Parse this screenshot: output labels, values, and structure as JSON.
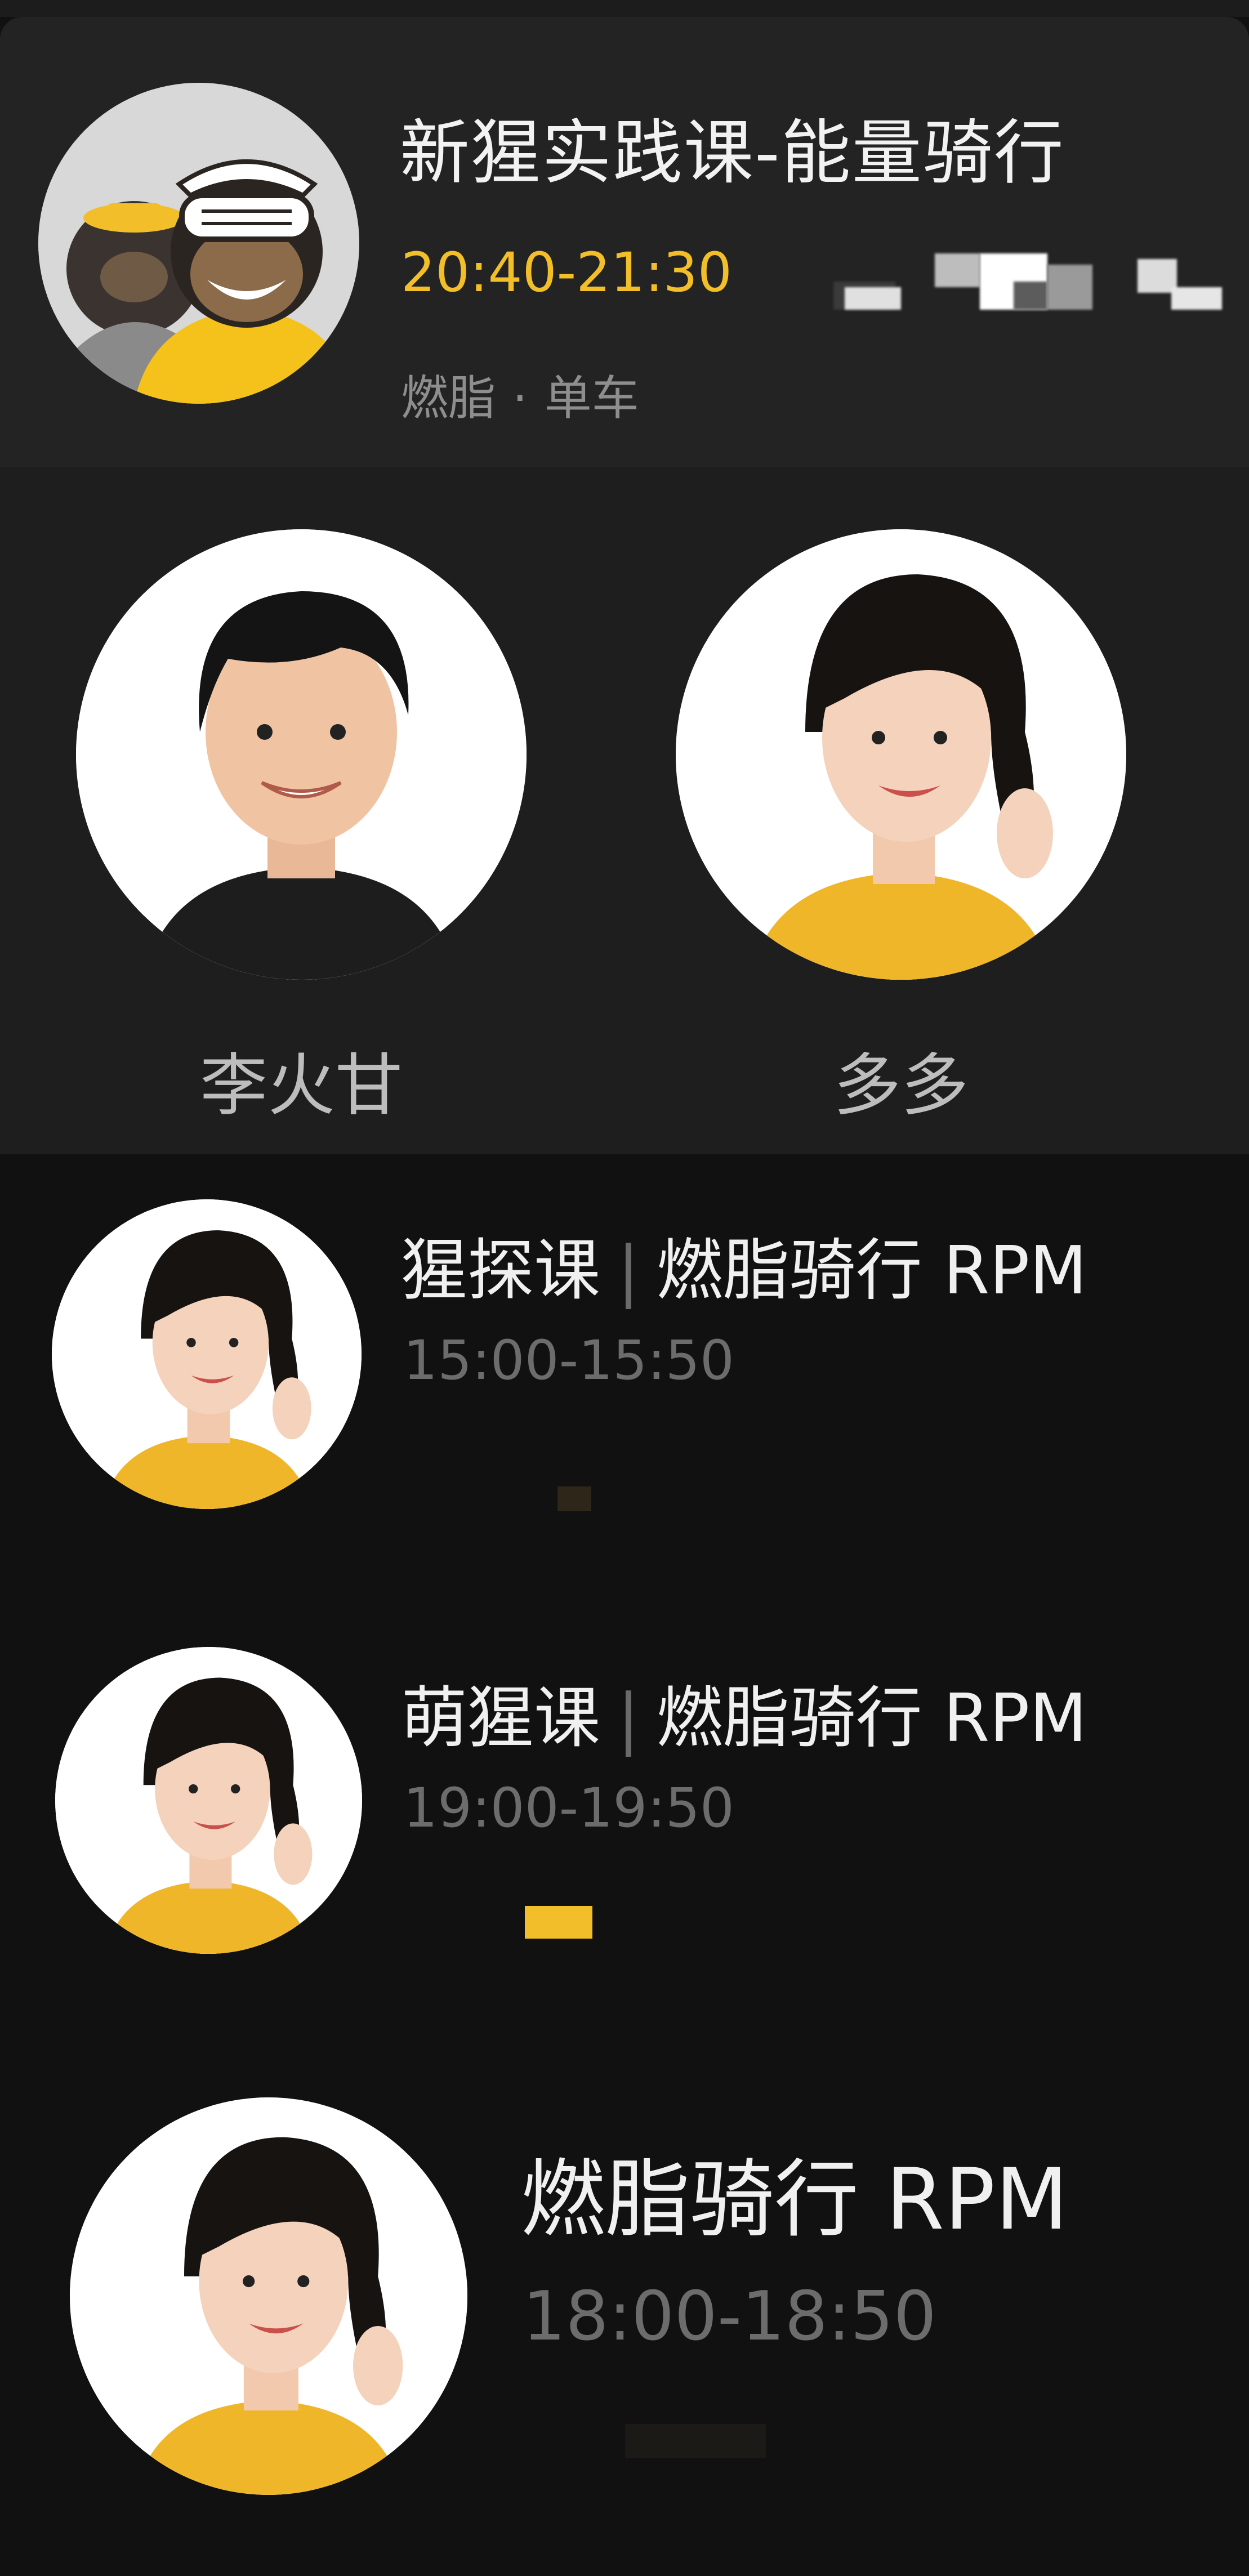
{
  "featured_class": {
    "title": "新猩实践课-能量骑行",
    "time": "20:40-21:30",
    "tags": [
      "燃脂",
      "单车"
    ],
    "tag_separator": "·",
    "avatar_icon": "gorilla-mascots-illustration",
    "accent_color": "#f2bf2a"
  },
  "coaches": [
    {
      "name": "李火甘",
      "avatar_icon": "coach-portrait"
    },
    {
      "name": "多多",
      "avatar_icon": "coach-portrait"
    }
  ],
  "classes": [
    {
      "prefix": "猩探课",
      "separator": "|",
      "name": "燃脂骑行 RPM",
      "time": "15:00-15:50",
      "avatar_icon": "coach-portrait"
    },
    {
      "prefix": "萌猩课",
      "separator": "|",
      "name": "燃脂骑行 RPM",
      "time": "19:00-19:50",
      "avatar_icon": "coach-portrait"
    },
    {
      "prefix": "",
      "separator": "",
      "name": "燃脂骑行 RPM",
      "time": "18:00-18:50",
      "avatar_icon": "coach-portrait"
    }
  ],
  "colors": {
    "background": "#111111",
    "card": "#232323",
    "coach_panel": "#1e1e1e",
    "time_text": "#6c6c6c",
    "accent_yellow": "#f2bf2a"
  }
}
